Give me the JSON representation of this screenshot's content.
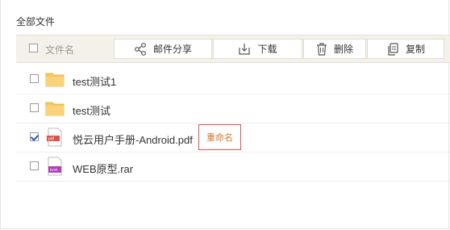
{
  "title": "全部文件",
  "toolbar": {
    "column_label": "文件名",
    "share_label": "邮件分享",
    "download_label": "下载",
    "delete_label": "删除",
    "copy_label": "复制",
    "share_icon": "share-icon",
    "download_icon": "download-icon",
    "delete_icon": "trash-icon",
    "copy_icon": "copy-icon"
  },
  "files": [
    {
      "name": "test测试1",
      "type": "folder",
      "checked": false
    },
    {
      "name": "test测试",
      "type": "folder",
      "checked": false
    },
    {
      "name": "悦云用户手册-Android.pdf",
      "type": "pdf",
      "checked": true
    },
    {
      "name": "WEB原型.rar",
      "type": "rar",
      "checked": false
    }
  ],
  "rename_label": "重命名",
  "colors": {
    "toolbar_bg": "#f4f1ea",
    "folder": "#f7c761",
    "pdf": "#d9534f",
    "rar": "#b23fb5",
    "rename_border": "#d9534f",
    "rename_text": "#d07a2a"
  }
}
